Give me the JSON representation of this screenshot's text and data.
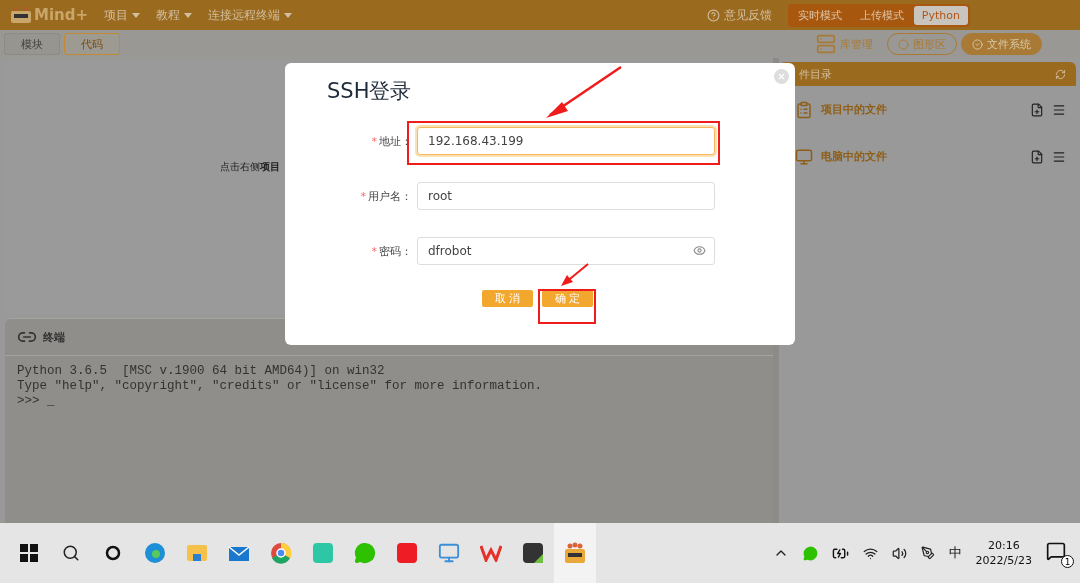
{
  "menu_bar": {
    "logo": "Mind+",
    "menus": [
      {
        "label": "项目"
      },
      {
        "label": "教程"
      },
      {
        "label": "连接远程终端"
      }
    ],
    "feedback": "意见反馈",
    "modes": [
      {
        "label": "实时模式",
        "selected": false
      },
      {
        "label": "上传模式",
        "selected": false
      },
      {
        "label": "Python",
        "selected": true
      }
    ]
  },
  "toolbar": {
    "tabs": [
      {
        "label": "模块",
        "selected": false
      },
      {
        "label": "代码",
        "selected": true
      }
    ],
    "views": [
      {
        "label": "库管理",
        "kind": "library"
      },
      {
        "label": "图形区",
        "kind": "graphics",
        "selected": false
      },
      {
        "label": "文件系统",
        "kind": "files",
        "selected": true
      }
    ]
  },
  "editor": {
    "hint": "点击右侧**项目**"
  },
  "terminal": {
    "title": "终端",
    "lines": [
      "Python 3.6.5  [MSC v.1900 64 bit AMD64)] on win32",
      "Type \"help\", \"copyright\", \"credits\" or \"license\" for more information.",
      ">>> _"
    ]
  },
  "file_panel": {
    "title": "件目录",
    "sections": [
      {
        "label": "项目中的文件",
        "kind": "project"
      },
      {
        "label": "电脑中的文件",
        "kind": "computer"
      }
    ]
  },
  "dialog": {
    "title": "SSH登录",
    "fields": [
      {
        "label": "地址：",
        "required_mark": "*",
        "value": "192.168.43.199",
        "kind": "text",
        "focused": true
      },
      {
        "label": "用户名：",
        "required_mark": "*",
        "value": "root",
        "kind": "text",
        "focused": false
      },
      {
        "label": "密码：",
        "required_mark": "*",
        "value": "dfrobot",
        "kind": "password",
        "focused": false
      }
    ],
    "buttons": [
      {
        "label": "取 消"
      },
      {
        "label": "确 定"
      }
    ]
  },
  "taskbar": {
    "input_method": "中",
    "time": "20:16",
    "date": "2022/5/23",
    "notifications": "1"
  }
}
